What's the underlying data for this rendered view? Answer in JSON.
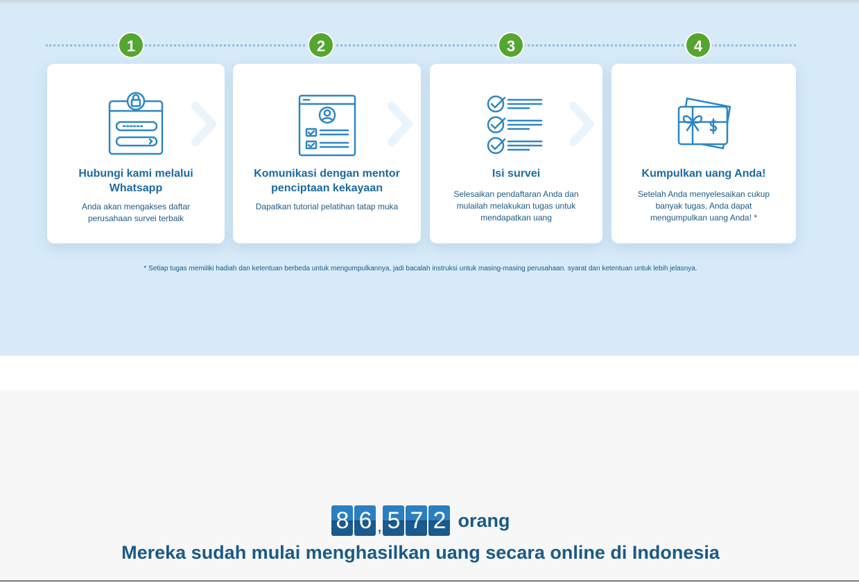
{
  "steps": [
    {
      "number": "1",
      "title": "Hubungi kami melalui Whatsapp",
      "desc": "Anda akan mengakses daftar perusahaan survei terbaik",
      "icon": "login-form-icon"
    },
    {
      "number": "2",
      "title": "Komunikasi dengan mentor penciptaan kekayaan",
      "desc": "Dapatkan tutorial pelatihan tatap muka",
      "icon": "profile-form-icon"
    },
    {
      "number": "3",
      "title": "Isi survei",
      "desc": "Selesaikan pendaftaran Anda dan mulailah melakukan tugas untuk mendapatkan uang",
      "icon": "checklist-icon"
    },
    {
      "number": "4",
      "title": "Kumpulkan uang Anda!",
      "desc": "Setelah Anda menyelesaikan cukup banyak tugas, Anda dapat mengumpulkan uang Anda! *",
      "icon": "gift-money-icon"
    }
  ],
  "footnote": "* Setiap tugas memiliki hadiah dan ketentuan berbeda untuk mengumpulkannya, jadi bacalah instruksi untuk masing-masing perusahaan. syarat dan ketentuan untuk lebih jelasnya.",
  "counter": {
    "digits": [
      "8",
      "6",
      "5",
      "7",
      "2"
    ],
    "separator": ",",
    "value": 86572,
    "unit": "orang"
  },
  "tagline": "Mereka sudah mulai menghasilkan uang secara online di Indonesia",
  "colors": {
    "section_bg": "#d6eaf8",
    "step_badge": "#55a630",
    "title": "#1d6a9e",
    "icon_stroke": "#2e86c1",
    "digit_bg": "#2b7fbf"
  }
}
